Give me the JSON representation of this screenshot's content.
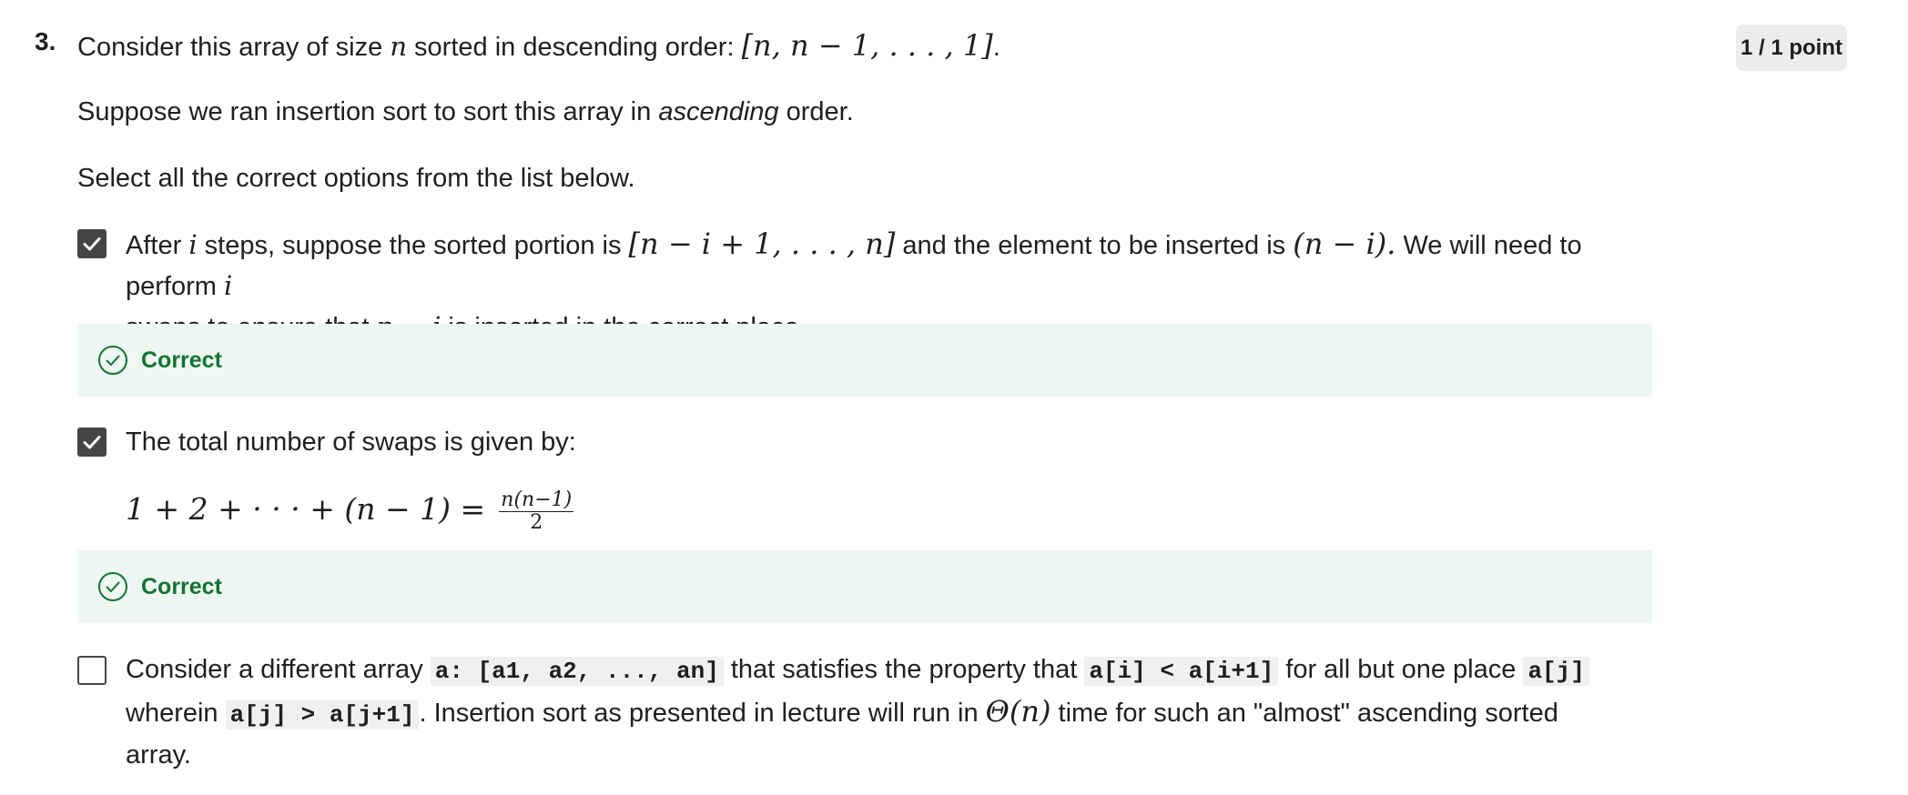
{
  "question": {
    "number": "3.",
    "points": "1 / 1 point",
    "stem_prefix": "Consider this array of size ",
    "stem_n": "n",
    "stem_mid": " sorted in descending order: ",
    "stem_array": "[n, n − 1, . . . , 1]",
    "stem_end": ".",
    "line2_prefix": "Suppose we ran insertion sort to sort this array in ",
    "line2_em": "ascending",
    "line2_suffix": " order.",
    "line3": "Select all the correct options from the list below."
  },
  "options": [
    {
      "checked": true,
      "t1": "After ",
      "m1": "i",
      "t2": " steps, suppose the sorted portion is ",
      "m2": "[n − i + 1, . . . , n]",
      "t3": " and the element to be inserted is ",
      "m3": "(n − i).",
      "t4": " We will need to perform ",
      "m4": "i",
      "t5": "swaps to ensure that ",
      "m5": "n − i",
      "t6": " is inserted in the correct place.",
      "feedback": "Correct"
    },
    {
      "checked": true,
      "t1": "The total number of swaps is given by:",
      "formula_lhs": "1 + 2 + · · · + (n − 1) =",
      "formula_num": "n(n−1)",
      "formula_den": "2",
      "feedback": "Correct"
    },
    {
      "checked": false,
      "t1": "Consider a different array ",
      "c1": "a: [a1, a2, ..., an]",
      "t2": " that satisfies the property that ",
      "c2": "a[i] < a[i+1]",
      "t3": " for all but one place ",
      "c3": "a[j]",
      "t4": "wherein ",
      "c4": "a[j] > a[j+1]",
      "t5": ". Insertion sort as presented in lecture will run in ",
      "m1": "Θ(n)",
      "t6": " time for such an \"almost\" ascending sorted array."
    }
  ],
  "colors": {
    "checkbox": "#454545",
    "feedback_bg": "#eef7f1",
    "correct_green": "#137333",
    "points_bg": "#ececec"
  }
}
